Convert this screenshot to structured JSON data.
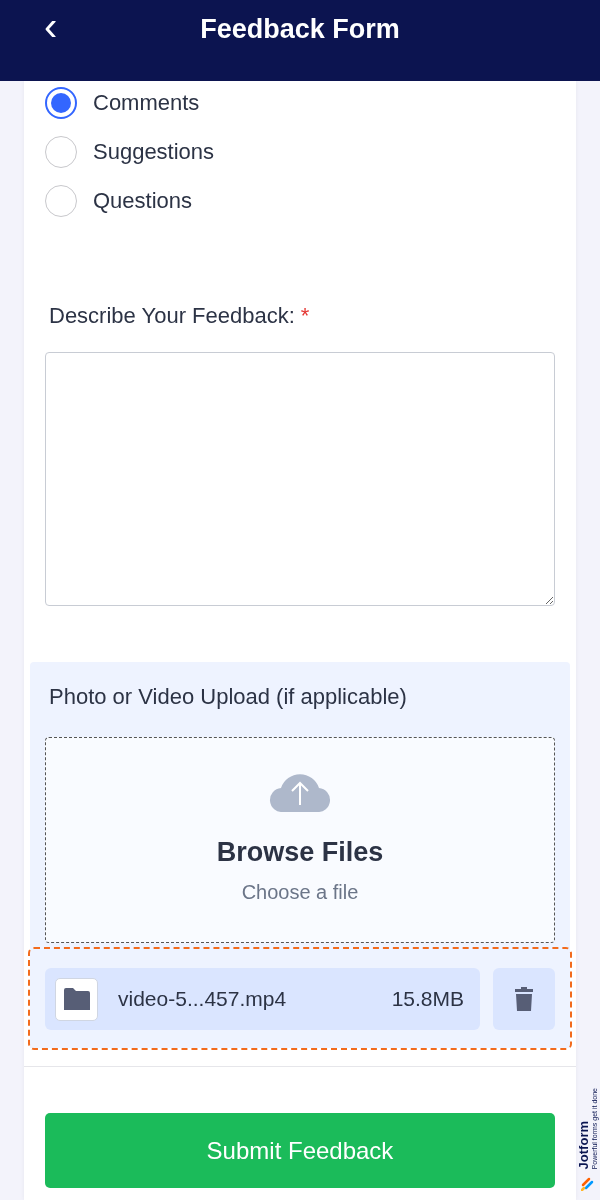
{
  "header": {
    "back_icon_glyph": "‹",
    "title": "Feedback Form"
  },
  "feedback_type": {
    "options": [
      {
        "label": "Comments",
        "selected": true
      },
      {
        "label": "Suggestions",
        "selected": false
      },
      {
        "label": "Questions",
        "selected": false
      }
    ]
  },
  "description": {
    "label": "Describe Your Feedback:",
    "required_mark": "*"
  },
  "upload": {
    "label": "Photo or Video Upload (if applicable)",
    "browse": "Browse Files",
    "hint": "Choose a file",
    "files": [
      {
        "name": "video-5...457.mp4",
        "size": "15.8MB"
      }
    ]
  },
  "submit": "Submit Feedback",
  "badge": {
    "brand": "Jotform",
    "tagline": "Powerful forms get it done"
  }
}
